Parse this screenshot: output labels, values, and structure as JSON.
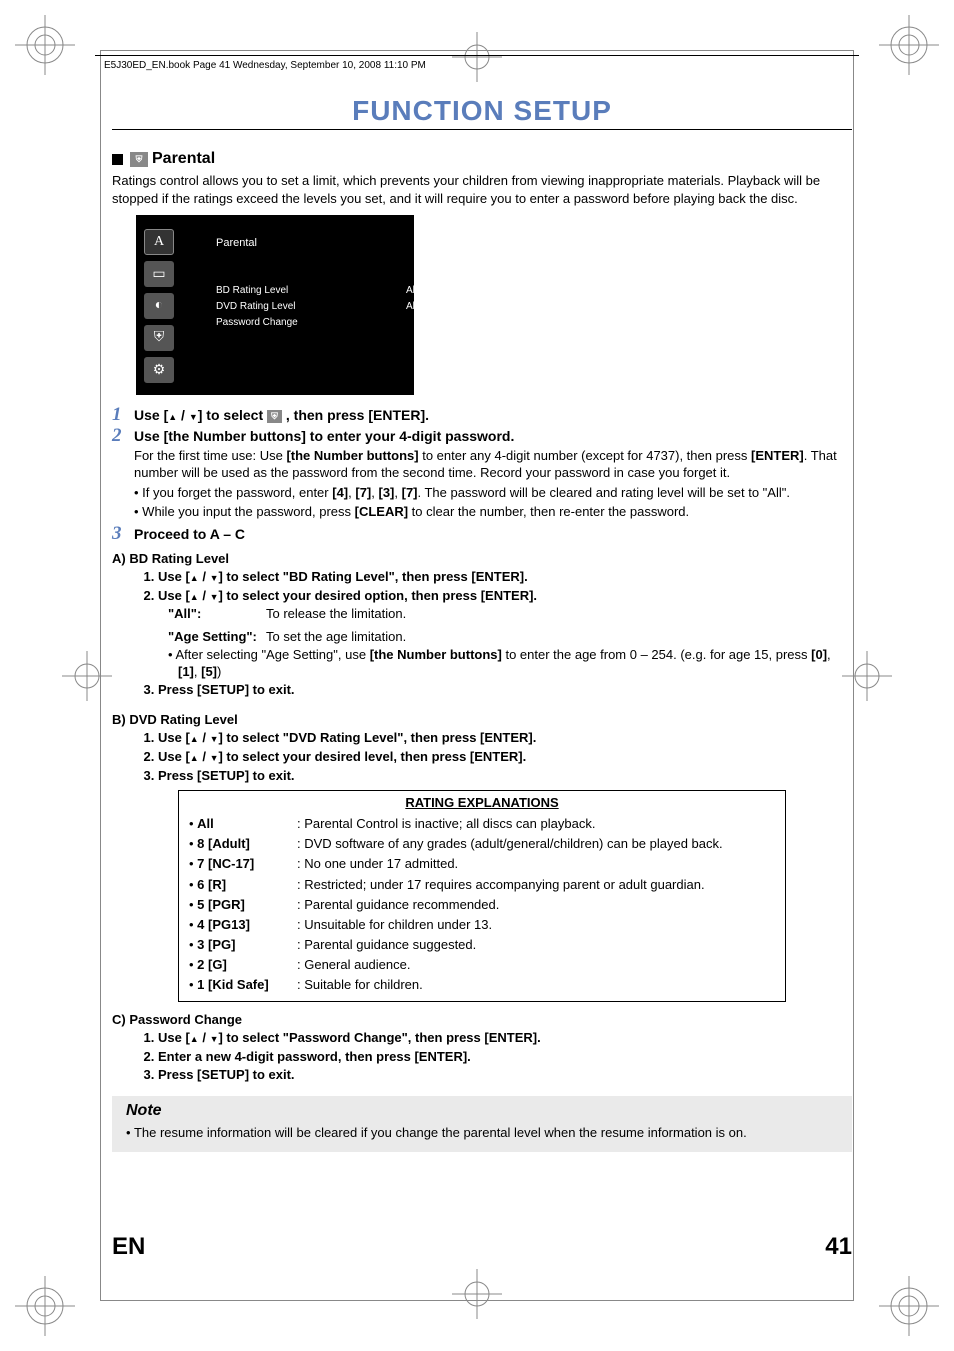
{
  "header_meta": "E5J30ED_EN.book  Page 41  Wednesday, September 10, 2008  11:10 PM",
  "page_title": "FUNCTION SETUP",
  "section": {
    "heading": "Parental",
    "lead": "Ratings control allows you to set a limit, which prevents your children from viewing inappropriate materials. Playback will be stopped if the ratings exceed the levels you set, and it will require you to enter a password before playing back the disc."
  },
  "menu": {
    "title": "Parental",
    "rows": [
      {
        "label": "BD Rating Level",
        "value": "All"
      },
      {
        "label": "DVD Rating Level",
        "value": "All"
      },
      {
        "label": "Password Change",
        "value": ""
      }
    ]
  },
  "steps": {
    "s1_a": "Use [",
    "s1_b": " / ",
    "s1_c": "] to select ",
    "s1_d": " , then press [ENTER].",
    "s2_title": "Use [the Number buttons] to enter your 4-digit password.",
    "s2_p_a": "For the first time use: Use ",
    "s2_p_b": "[the Number buttons]",
    "s2_p_c": " to enter any 4-digit number (except for 4737), then press ",
    "s2_p_d": "[ENTER]",
    "s2_p_e": ". That number will be used as the password from the second time. Record your password in case you forget it.",
    "s2_li1_a": "If you forget the password, enter ",
    "s2_li1_b": "[4]",
    "s2_li1_c": ", ",
    "s2_li1_d": "[7]",
    "s2_li1_e": ", ",
    "s2_li1_f": "[3]",
    "s2_li1_g": ", ",
    "s2_li1_h": "[7]",
    "s2_li1_i": ". The password will be cleared and rating level will be set to \"All\".",
    "s2_li2_a": "While you input the password, press ",
    "s2_li2_b": "[CLEAR]",
    "s2_li2_c": " to clear the number, then re-enter the password.",
    "s3_title": "Proceed to A – C"
  },
  "A": {
    "heading": "A)  BD Rating Level",
    "l1_a": "Use [",
    "l1_b": " / ",
    "l1_c": "] to select \"BD Rating Level\", then press [ENTER].",
    "l2_a": "Use [",
    "l2_b": " / ",
    "l2_c": "] to select your desired option, then press [ENTER].",
    "opt1_label": "\"All\":",
    "opt1_desc": "To release the limitation.",
    "opt2_label": "\"Age Setting\":",
    "opt2_desc": "To set the age limitation.",
    "bul_a": "After selecting \"Age Setting\", use ",
    "bul_b": "[the Number buttons]",
    "bul_c": " to enter the age from 0 – 254. (e.g. for age 15, press ",
    "bul_d": "[0]",
    "bul_e": ", ",
    "bul_f": "[1]",
    "bul_g": ", ",
    "bul_h": "[5]",
    "bul_i": ")",
    "l3": "Press [SETUP] to exit."
  },
  "B": {
    "heading": "B)  DVD Rating Level",
    "l1_a": "Use [",
    "l1_b": " / ",
    "l1_c": "] to select \"DVD Rating Level\", then press [ENTER].",
    "l2_a": "Use [",
    "l2_b": " / ",
    "l2_c": "] to select your desired level, then press [ENTER].",
    "l3": "Press [SETUP] to exit."
  },
  "ratings": {
    "title": "RATING EXPLANATIONS",
    "rows": [
      {
        "label": "All",
        "desc": "Parental Control is inactive; all discs can playback."
      },
      {
        "label": "8 [Adult]",
        "desc": "DVD software of any grades (adult/general/children) can be played back."
      },
      {
        "label": "7 [NC-17]",
        "desc": " No one under 17 admitted."
      },
      {
        "label": "6 [R]",
        "desc": " Restricted; under 17 requires accompanying parent or adult guardian."
      },
      {
        "label": "5 [PGR]",
        "desc": " Parental guidance recommended."
      },
      {
        "label": "4 [PG13]",
        "desc": " Unsuitable for children under 13."
      },
      {
        "label": "3 [PG]",
        "desc": " Parental guidance suggested."
      },
      {
        "label": "2 [G]",
        "desc": " General audience."
      },
      {
        "label": "1 [Kid Safe]",
        "desc": "Suitable for children."
      }
    ]
  },
  "C": {
    "heading": "C)  Password Change",
    "l1_a": "Use [",
    "l1_b": " / ",
    "l1_c": "] to select \"Password Change\", then press [ENTER].",
    "l2": "Enter a new 4-digit password, then press [ENTER].",
    "l3": "Press [SETUP] to exit."
  },
  "note": {
    "title": "Note",
    "body": "The resume information will be cleared if you change the parental level when the resume information is on."
  },
  "footer": {
    "lang": "EN",
    "page": "41"
  }
}
